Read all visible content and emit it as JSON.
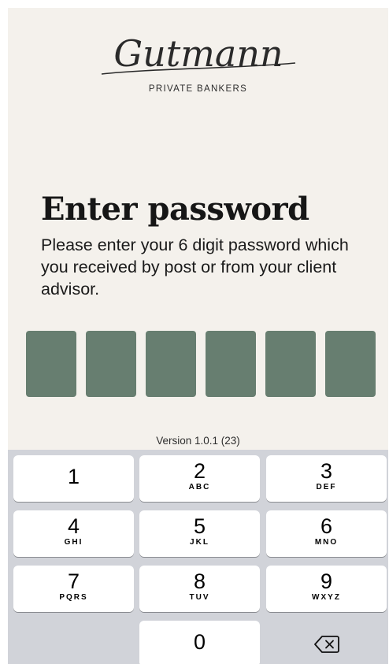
{
  "logo": {
    "script_text": "Gutmann",
    "subtitle": "PRIVATE BANKERS"
  },
  "title": "Enter password",
  "description": "Please enter your 6 digit password which you received by post or from your client advisor.",
  "pin": {
    "length": 6,
    "box_color": "#677e70"
  },
  "version": "Version 1.0.1 (23)",
  "keypad": {
    "keys": [
      {
        "digit": "1",
        "letters": ""
      },
      {
        "digit": "2",
        "letters": "ABC"
      },
      {
        "digit": "3",
        "letters": "DEF"
      },
      {
        "digit": "4",
        "letters": "GHI"
      },
      {
        "digit": "5",
        "letters": "JKL"
      },
      {
        "digit": "6",
        "letters": "MNO"
      },
      {
        "digit": "7",
        "letters": "PQRS"
      },
      {
        "digit": "8",
        "letters": "TUV"
      },
      {
        "digit": "9",
        "letters": "WXYZ"
      },
      {
        "digit": "0",
        "letters": ""
      }
    ],
    "backspace_icon": "backspace-icon",
    "background": "#d1d3d9"
  }
}
